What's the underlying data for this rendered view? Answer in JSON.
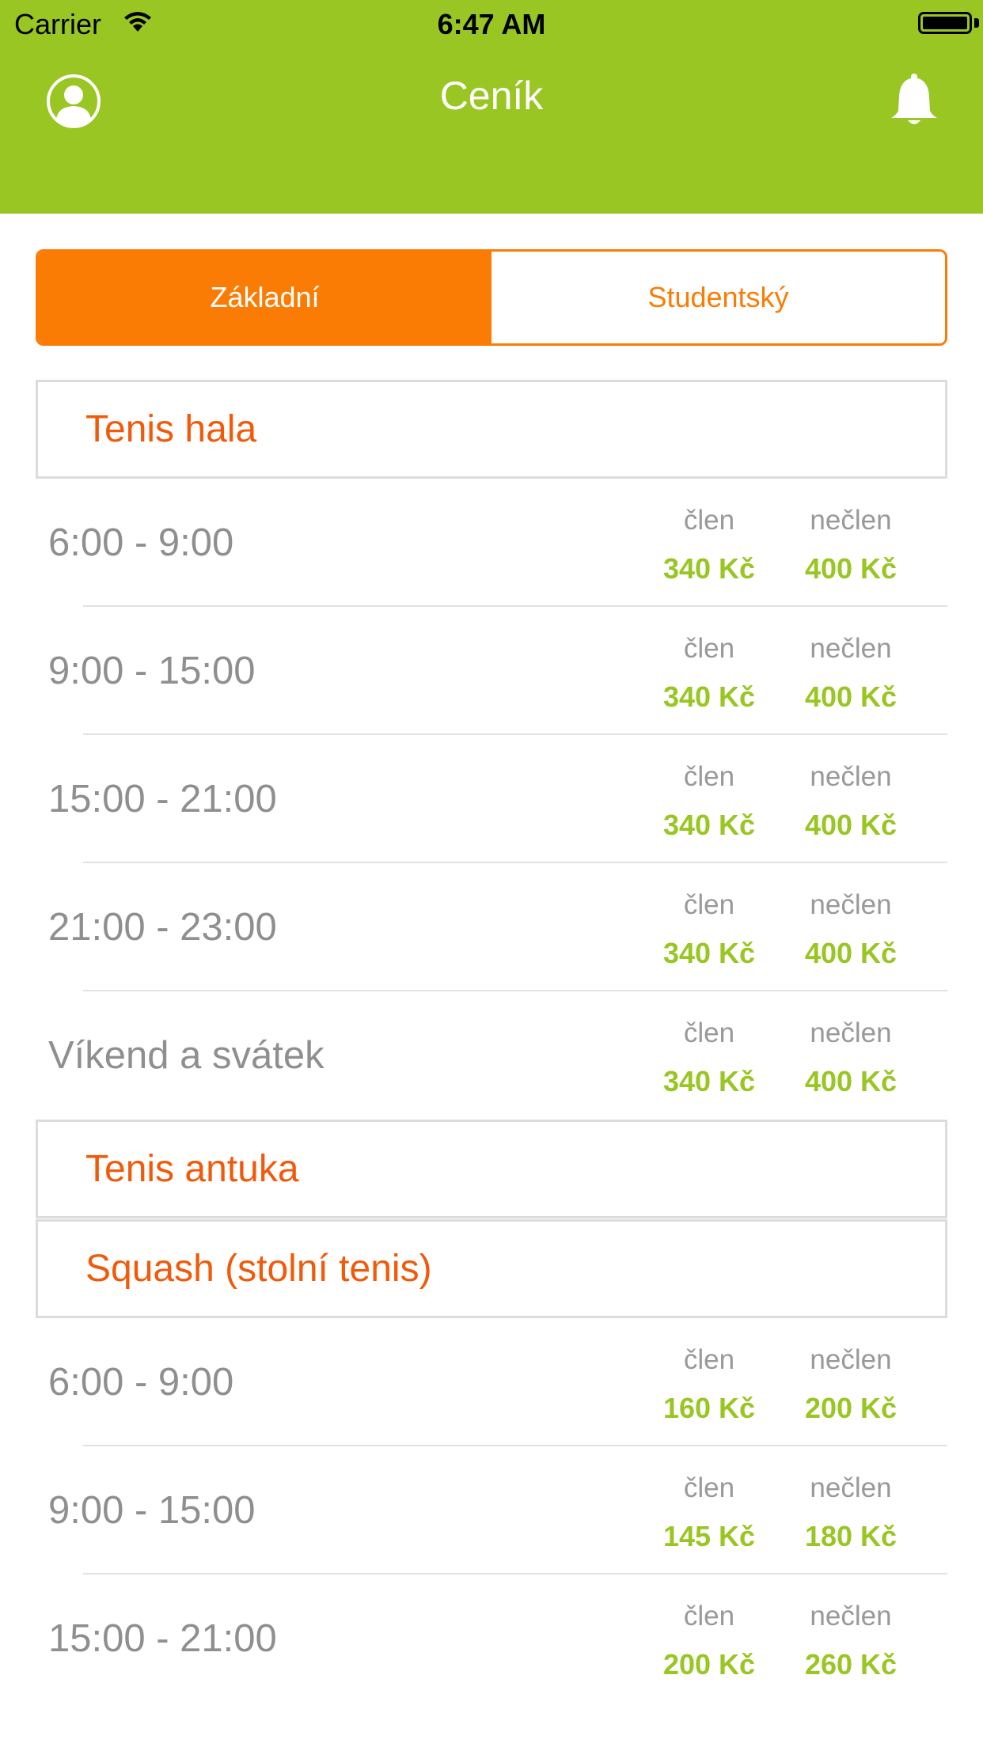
{
  "status_bar": {
    "carrier": "Carrier",
    "time": "6:47 AM"
  },
  "nav": {
    "title": "Ceník"
  },
  "tabs": [
    {
      "label": "Základní",
      "active": true
    },
    {
      "label": "Studentský",
      "active": false
    }
  ],
  "sections": [
    {
      "title": "Tenis hala",
      "rows": [
        {
          "time": "6:00 - 9:00",
          "member_label": "člen",
          "nonmember_label": "nečlen",
          "member_price": "340 Kč",
          "nonmember_price": "400 Kč"
        },
        {
          "time": "9:00 - 15:00",
          "member_label": "člen",
          "nonmember_label": "nečlen",
          "member_price": "340 Kč",
          "nonmember_price": "400 Kč"
        },
        {
          "time": "15:00 - 21:00",
          "member_label": "člen",
          "nonmember_label": "nečlen",
          "member_price": "340 Kč",
          "nonmember_price": "400 Kč"
        },
        {
          "time": "21:00 - 23:00",
          "member_label": "člen",
          "nonmember_label": "nečlen",
          "member_price": "340 Kč",
          "nonmember_price": "400 Kč"
        },
        {
          "time": "Víkend a svátek",
          "member_label": "člen",
          "nonmember_label": "nečlen",
          "member_price": "340 Kč",
          "nonmember_price": "400 Kč"
        }
      ]
    },
    {
      "title": "Tenis antuka",
      "rows": []
    },
    {
      "title": "Squash (stolní tenis)",
      "rows": [
        {
          "time": "6:00 - 9:00",
          "member_label": "člen",
          "nonmember_label": "nečlen",
          "member_price": "160 Kč",
          "nonmember_price": "200 Kč"
        },
        {
          "time": "9:00 - 15:00",
          "member_label": "člen",
          "nonmember_label": "nečlen",
          "member_price": "145 Kč",
          "nonmember_price": "180 Kč"
        },
        {
          "time": "15:00 - 21:00",
          "member_label": "člen",
          "nonmember_label": "nečlen",
          "member_price": "200 Kč",
          "nonmember_price": "260 Kč"
        }
      ]
    }
  ],
  "colors": {
    "header_green": "#99c623",
    "accent_orange": "#fb7c04",
    "section_title": "#f15a0b",
    "price_green": "#99c623",
    "text_gray": "#8f8f8f"
  },
  "icons": {
    "profile": "profile-icon",
    "notifications": "bell-icon",
    "wifi": "wifi-icon",
    "battery": "battery-icon"
  }
}
